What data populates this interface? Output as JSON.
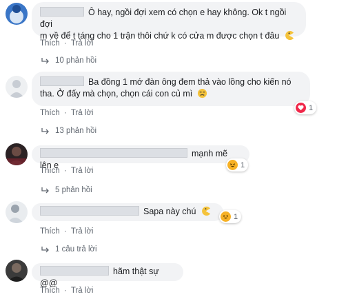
{
  "comments": [
    {
      "text": "Ô hay, ngồi đợi xem có chọn e hay không. Ok t ngồi đợi m về để t tặng cho 1 trận thôi chứ k có cửa m được chọn t đâu",
      "line1": "Ô hay, ngồi đợi xem có chọn e hay không. Ok t ngồi đợi",
      "line2": "m về để t táng cho 1 trận thôi chứ k có cửa m được chọn t đâu",
      "like": "Thích",
      "reply": "Trả lời",
      "replies": "10 phản hồi"
    },
    {
      "line1": "Ba đồng 1 mớ đàn ông đem thả vào lồng cho kiến nó",
      "line2": "tha. Ở đấy mà chọn, chọn cái con củ mì",
      "like": "Thích",
      "reply": "Trả lời",
      "reaction_count": "1",
      "replies": "13 phản hồi"
    },
    {
      "line1": "mạnh mẽ lên e",
      "like": "Thích",
      "reply": "Trả lời",
      "reaction_count": "1",
      "replies": "5 phản hồi"
    },
    {
      "line1": "Sapa này chú",
      "like": "Thích",
      "reply": "Trả lời",
      "reaction_count": "1",
      "replies": "1 câu trả lời"
    },
    {
      "line1": "hãm thật sự @@",
      "like": "Thích",
      "reply": "Trả lời"
    }
  ],
  "separator": "·",
  "colors": {
    "bubble": "#f2f3f5",
    "meta_text": "#606770",
    "love": "#f0284a",
    "haha": "#f7b125"
  },
  "icons": [
    "reply-arrow-icon",
    "love-reaction-icon",
    "haha-reaction-icon",
    "emoji-pacman-icon",
    "emoji-grin-icon"
  ]
}
